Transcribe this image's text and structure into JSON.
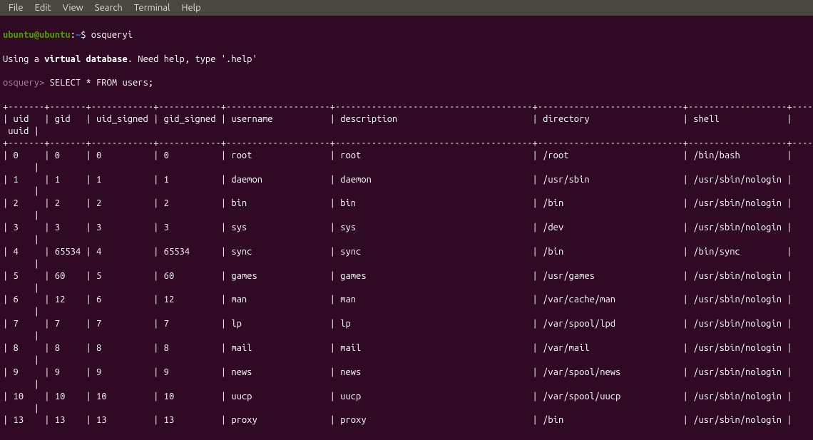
{
  "menubar": {
    "items": [
      "File",
      "Edit",
      "View",
      "Search",
      "Terminal",
      "Help"
    ]
  },
  "prompt": {
    "user": "ubuntu",
    "host": "ubuntu",
    "path": "~",
    "separator": "@",
    "dollar": "$"
  },
  "command1": "osqueryi",
  "help_line_prefix": "Using a ",
  "help_line_bold": "virtual database",
  "help_line_suffix": ". Need help, type '.help'",
  "osquery_prompt": "osquery>",
  "query": " SELECT * FROM users;",
  "table": {
    "top_border": "+-------+-------+------------+------------+--------------------+--------------------------------------+----------------------------+-------------------+------+",
    "header_line1": "| uid   | gid   | uid_signed | gid_signed | username           | description                          | directory                  | shell             |",
    "header_line2": " uuid |",
    "sep_border": "+-------+-------+------------+------------+--------------------+--------------------------------------+----------------------------+-------------------+------+",
    "columns": [
      "uid",
      "gid",
      "uid_signed",
      "gid_signed",
      "username",
      "description",
      "directory",
      "shell"
    ],
    "widths": {
      "uid": 5,
      "gid": 5,
      "uid_signed": 10,
      "gid_signed": 10,
      "username": 18,
      "description": 36,
      "directory": 26,
      "shell": 17
    },
    "rows": [
      {
        "uid": "0",
        "gid": "0",
        "uid_signed": "0",
        "gid_signed": "0",
        "username": "root",
        "description": "root",
        "directory": "/root",
        "shell": "/bin/bash"
      },
      {
        "uid": "1",
        "gid": "1",
        "uid_signed": "1",
        "gid_signed": "1",
        "username": "daemon",
        "description": "daemon",
        "directory": "/usr/sbin",
        "shell": "/usr/sbin/nologin"
      },
      {
        "uid": "2",
        "gid": "2",
        "uid_signed": "2",
        "gid_signed": "2",
        "username": "bin",
        "description": "bin",
        "directory": "/bin",
        "shell": "/usr/sbin/nologin"
      },
      {
        "uid": "3",
        "gid": "3",
        "uid_signed": "3",
        "gid_signed": "3",
        "username": "sys",
        "description": "sys",
        "directory": "/dev",
        "shell": "/usr/sbin/nologin"
      },
      {
        "uid": "4",
        "gid": "65534",
        "uid_signed": "4",
        "gid_signed": "65534",
        "username": "sync",
        "description": "sync",
        "directory": "/bin",
        "shell": "/bin/sync"
      },
      {
        "uid": "5",
        "gid": "60",
        "uid_signed": "5",
        "gid_signed": "60",
        "username": "games",
        "description": "games",
        "directory": "/usr/games",
        "shell": "/usr/sbin/nologin"
      },
      {
        "uid": "6",
        "gid": "12",
        "uid_signed": "6",
        "gid_signed": "12",
        "username": "man",
        "description": "man",
        "directory": "/var/cache/man",
        "shell": "/usr/sbin/nologin"
      },
      {
        "uid": "7",
        "gid": "7",
        "uid_signed": "7",
        "gid_signed": "7",
        "username": "lp",
        "description": "lp",
        "directory": "/var/spool/lpd",
        "shell": "/usr/sbin/nologin"
      },
      {
        "uid": "8",
        "gid": "8",
        "uid_signed": "8",
        "gid_signed": "8",
        "username": "mail",
        "description": "mail",
        "directory": "/var/mail",
        "shell": "/usr/sbin/nologin"
      },
      {
        "uid": "9",
        "gid": "9",
        "uid_signed": "9",
        "gid_signed": "9",
        "username": "news",
        "description": "news",
        "directory": "/var/spool/news",
        "shell": "/usr/sbin/nologin"
      },
      {
        "uid": "10",
        "gid": "10",
        "uid_signed": "10",
        "gid_signed": "10",
        "username": "uucp",
        "description": "uucp",
        "directory": "/var/spool/uucp",
        "shell": "/usr/sbin/nologin"
      },
      {
        "uid": "13",
        "gid": "13",
        "uid_signed": "13",
        "gid_signed": "13",
        "username": "proxy",
        "description": "proxy",
        "directory": "/bin",
        "shell": "/usr/sbin/nologin"
      }
    ],
    "wrap_suffix": "      |"
  }
}
